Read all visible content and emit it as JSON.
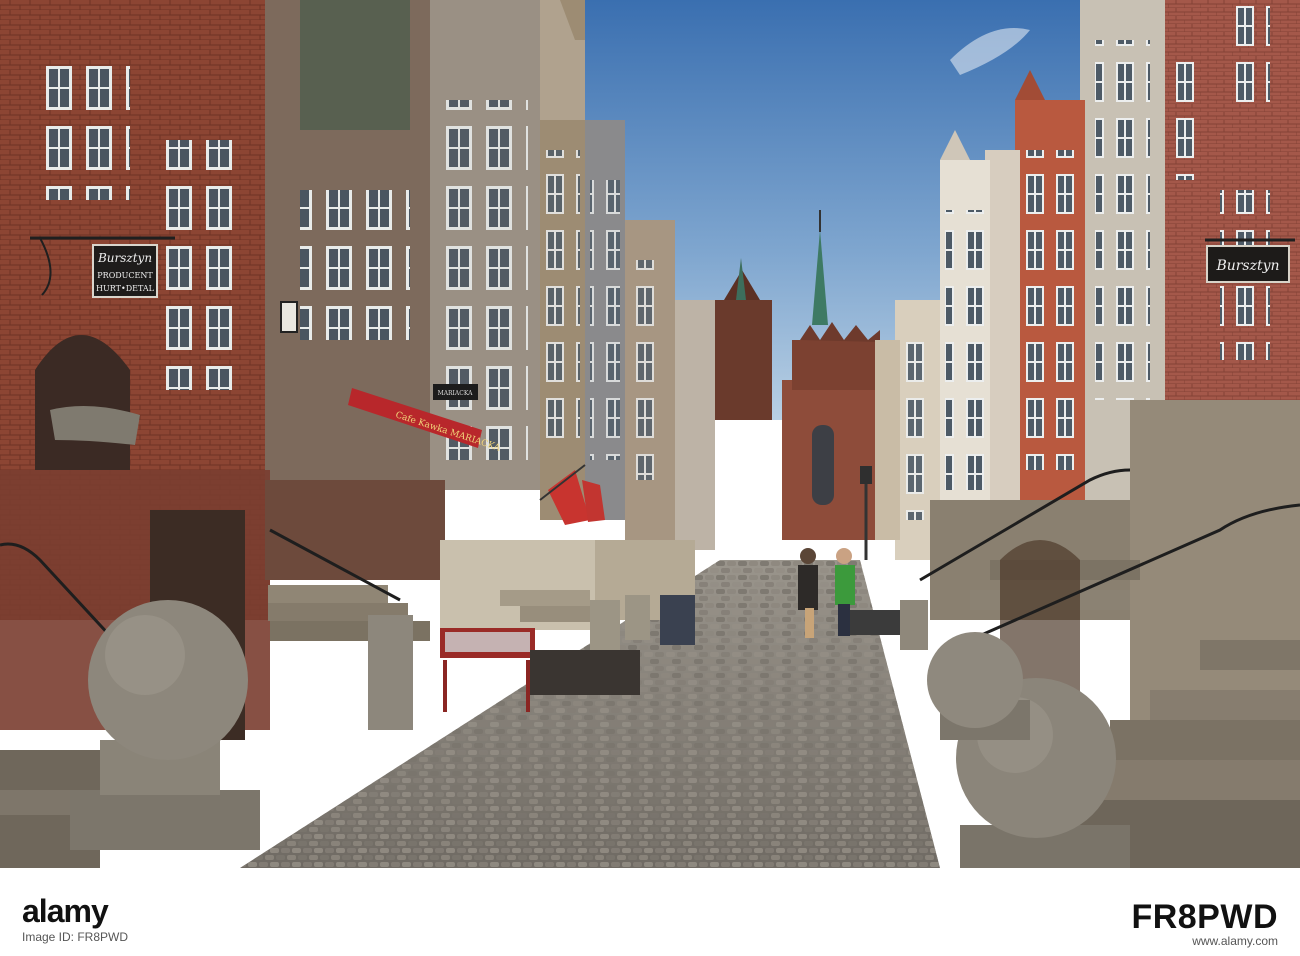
{
  "scene": {
    "description_colors": {
      "sky_top": "#3f74b3",
      "sky_bottom": "#a9c7e0",
      "brick": "#8f4a38",
      "stone": "#8a8478",
      "cobble": "#7f7a72",
      "flag_red": "#c8342f"
    },
    "signs": {
      "left_sign_line1": "Bursztyn",
      "left_sign_line2": "PRODUCENT",
      "left_sign_line3": "HURT•DETAL",
      "right_sign": "Bursztyn",
      "awning_text": "Cafe Kawka MARIACKA",
      "hanging_sign": "MARIACKA"
    }
  },
  "watermark": {
    "logo_left": "alamy",
    "image_id_label": "Image ID: FR8PWD",
    "site": "www.alamy.com",
    "logo_code": "FR8PWD"
  }
}
